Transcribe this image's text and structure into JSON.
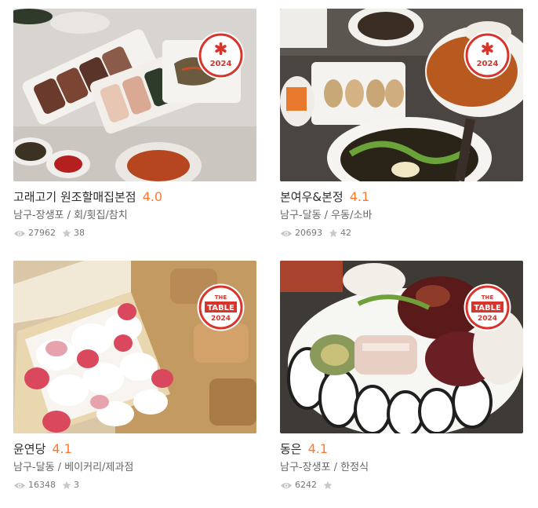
{
  "restaurants": [
    {
      "name": "고래고기 원조할매집본점",
      "rating": "4.0",
      "region": "남구-장생포",
      "category": "회/횟집/참치",
      "views": "27962",
      "favorites": "38",
      "badge": {
        "type": "star",
        "year": "2024"
      }
    },
    {
      "name": "본여우&본정",
      "rating": "4.1",
      "region": "남구-달동",
      "category": "우동/소바",
      "views": "20693",
      "favorites": "42",
      "badge": {
        "type": "star",
        "year": "2024"
      }
    },
    {
      "name": "윤연당",
      "rating": "4.1",
      "region": "남구-달동",
      "category": "베이커리/제과점",
      "views": "16348",
      "favorites": "3",
      "badge": {
        "type": "table",
        "line1": "THE",
        "line2": "TABLE",
        "year": "2024"
      }
    },
    {
      "name": "동은",
      "rating": "4.1",
      "region": "남구-장생포",
      "category": "한정식",
      "views": "6242",
      "favorites": "",
      "badge": {
        "type": "table",
        "line1": "THE",
        "line2": "TABLE",
        "year": "2024"
      }
    }
  ],
  "separator": " / ",
  "colors": {
    "accent": "#ff792a",
    "badge_red": "#d8342b"
  },
  "icons": {
    "views": "eye-icon",
    "favorites": "star-icon"
  }
}
